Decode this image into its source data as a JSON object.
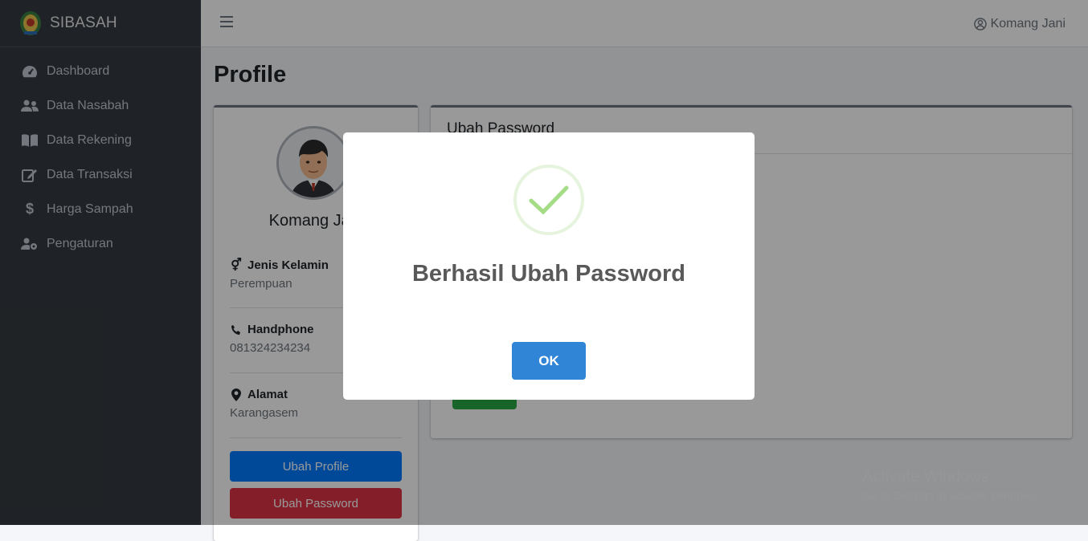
{
  "brand": {
    "name": "SIBASAH"
  },
  "sidebar": {
    "items": [
      {
        "label": "Dashboard",
        "icon": "tachometer-icon"
      },
      {
        "label": "Data Nasabah",
        "icon": "users-icon"
      },
      {
        "label": "Data Rekening",
        "icon": "book-icon"
      },
      {
        "label": "Data Transaksi",
        "icon": "edit-icon"
      },
      {
        "label": "Harga Sampah",
        "icon": "dollar-icon"
      },
      {
        "label": "Pengaturan",
        "icon": "user-cog-icon"
      }
    ]
  },
  "header": {
    "user_name": "Komang Jani"
  },
  "page": {
    "title": "Profile"
  },
  "profile": {
    "name": "Komang Jani",
    "fields": [
      {
        "label": "Jenis Kelamin",
        "value": "Perempuan"
      },
      {
        "label": "Handphone",
        "value": "081324234234"
      },
      {
        "label": "Alamat",
        "value": "Karangasem"
      }
    ],
    "edit_profile_label": "Ubah Profile",
    "edit_password_label": "Ubah Password"
  },
  "password_card": {
    "title": "Ubah Password"
  },
  "watermark": {
    "title": "Activate Windows",
    "subtitle": "Go to Settings to activate Windows."
  },
  "modal": {
    "title": "Berhasil Ubah Password",
    "ok_label": "OK"
  },
  "colors": {
    "sidebar_bg": "#343a40",
    "primary": "#007bff",
    "danger": "#dc3545",
    "success": "#28a745",
    "modal_button": "#3085d6",
    "success_check": "#a5dc86"
  }
}
